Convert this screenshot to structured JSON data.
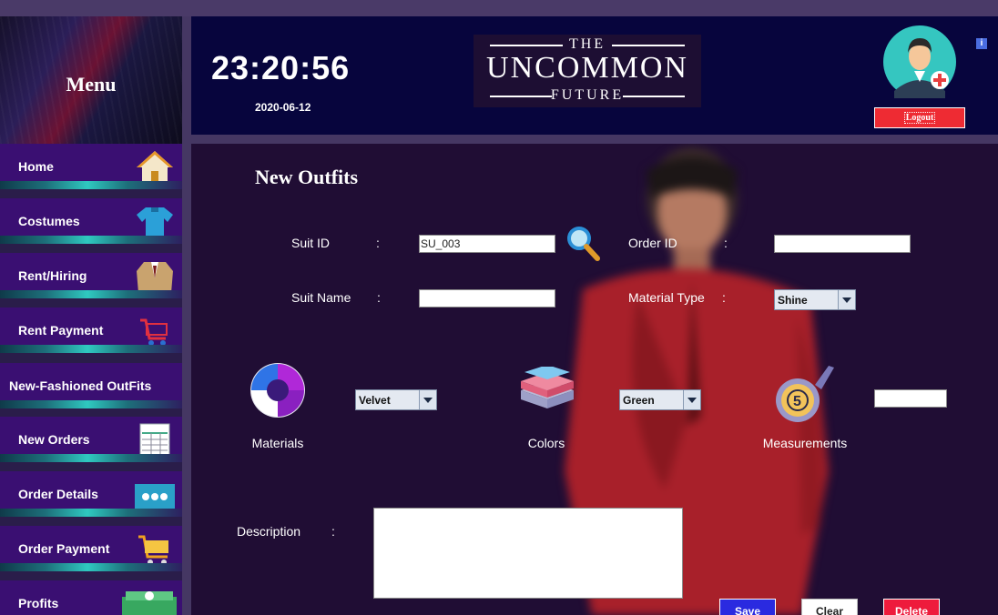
{
  "sidebar": {
    "title": "Menu",
    "items": [
      {
        "label": "Home",
        "icon": "home-icon"
      },
      {
        "label": "Costumes",
        "icon": "shirt-icon"
      },
      {
        "label": "Rent/Hiring",
        "icon": "suit-icon"
      },
      {
        "label": "Rent Payment",
        "icon": "cart-icon"
      },
      {
        "label": "New-Fashioned OutFits",
        "icon": ""
      },
      {
        "label": "New Orders",
        "icon": "spreadsheet-icon"
      },
      {
        "label": "Order Details",
        "icon": "more-dots-icon"
      },
      {
        "label": "Order Payment",
        "icon": "shopping-cart-icon"
      },
      {
        "label": "Profits",
        "icon": "money-stack-icon"
      }
    ]
  },
  "header": {
    "time": "23:20:56",
    "date": "2020-06-12",
    "logo": {
      "top": "THE",
      "middle": "UNCOMMON",
      "bottom": "FUTURE"
    },
    "logout_label": "Logout",
    "info_glyph": "i"
  },
  "form": {
    "title": "New Outfits",
    "suit_id": {
      "label": "Suit  ID",
      "value": "SU_003"
    },
    "order_id": {
      "label": "Order ID",
      "value": ""
    },
    "suit_name": {
      "label": "Suit  Name",
      "value": ""
    },
    "material_type": {
      "label": "Material  Type",
      "value": "Shine"
    },
    "colon": ":",
    "materials": {
      "caption": "Materials",
      "value": "Velvet"
    },
    "colors": {
      "caption": "Colors",
      "value": "Green"
    },
    "measurements": {
      "caption": "Measurements",
      "value": ""
    },
    "description": {
      "label": "Description",
      "value": ""
    },
    "buttons": {
      "save": "Save",
      "clear": "Clear",
      "delete": "Delete"
    }
  },
  "colors": {
    "sidebar_item": "#3a0f72",
    "header_bg": "#07053d",
    "main_bg": "#200d34",
    "save": "#2a2ae0",
    "delete": "#ee1b3c",
    "logout": "#ee2b33"
  }
}
